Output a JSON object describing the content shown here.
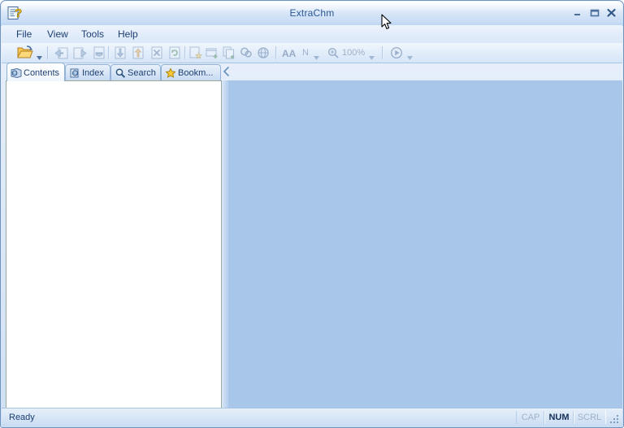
{
  "window": {
    "title": "ExtraChm",
    "app_icon": "chm-help-document-icon",
    "controls": {
      "minimize": "Minimize",
      "maximize": "Maximize",
      "close": "Close"
    },
    "frame_color": "#6f93bf",
    "titlebar_text_color": "#2b5797"
  },
  "menubar": {
    "items": [
      {
        "label": "File"
      },
      {
        "label": "View"
      },
      {
        "label": "Tools"
      },
      {
        "label": "Help"
      }
    ]
  },
  "toolbar": {
    "items": [
      {
        "name": "open-file-button",
        "icon": "open-folder-icon",
        "enabled": true,
        "has_dropdown": true
      },
      {
        "name": "back-button",
        "icon": "back-arrow-page-icon",
        "enabled": false
      },
      {
        "name": "forward-button",
        "icon": "forward-arrow-page-icon",
        "enabled": false
      },
      {
        "name": "home-button",
        "icon": "home-page-icon",
        "enabled": false
      },
      {
        "name": "previous-topic-button",
        "icon": "page-down-arrow-icon",
        "enabled": false
      },
      {
        "name": "next-topic-button",
        "icon": "page-up-arrow-icon",
        "enabled": false
      },
      {
        "name": "stop-button",
        "icon": "stop-page-x-icon",
        "enabled": false
      },
      {
        "name": "refresh-button",
        "icon": "refresh-page-icon",
        "enabled": false
      },
      {
        "name": "add-bookmark-button",
        "icon": "page-add-star-icon",
        "enabled": false
      },
      {
        "name": "new-window-button",
        "icon": "new-window-icon",
        "enabled": false
      },
      {
        "name": "copy-button",
        "icon": "copy-pages-icon",
        "enabled": false
      },
      {
        "name": "find-button",
        "icon": "magnifier-find-icon",
        "enabled": false
      },
      {
        "name": "print-button",
        "icon": "print-globe-icon",
        "enabled": false
      },
      {
        "name": "font-size-button",
        "icon": "font-size-AA-icon",
        "enabled": false
      },
      {
        "name": "font-style-button",
        "icon": "font-normal-N-icon",
        "enabled": false,
        "has_dropdown": true
      },
      {
        "name": "zoom-button",
        "icon": "zoom-magnifier-icon",
        "enabled": false,
        "has_dropdown": true
      },
      {
        "name": "play-button",
        "icon": "play-circle-icon",
        "enabled": false,
        "has_dropdown": true
      }
    ],
    "font_style_label": "N",
    "zoom_label": "100%",
    "font_size_label": "AA"
  },
  "tabs": {
    "items": [
      {
        "label": "Contents",
        "icon": "contents-book-help-icon",
        "active": true
      },
      {
        "label": "Index",
        "icon": "index-book-help-icon",
        "active": false
      },
      {
        "label": "Search",
        "icon": "search-magnifier-icon",
        "active": false
      },
      {
        "label": "Bookm...",
        "icon": "bookmark-star-icon",
        "active": false
      }
    ],
    "scroll_icon": "chevron-left-icon"
  },
  "panels": {
    "tree": {
      "name": "contents-tree",
      "content": "",
      "background": "#ffffff"
    },
    "content": {
      "name": "topic-view",
      "content": "",
      "background": "#a8c6ea"
    },
    "splitter": {
      "name": "panel-splitter"
    }
  },
  "statusbar": {
    "message": "Ready",
    "indicators": [
      {
        "label": "CAP",
        "active": false
      },
      {
        "label": "NUM",
        "active": true
      },
      {
        "label": "SCRL",
        "active": false
      }
    ],
    "grip": "resize-grip-icon"
  }
}
